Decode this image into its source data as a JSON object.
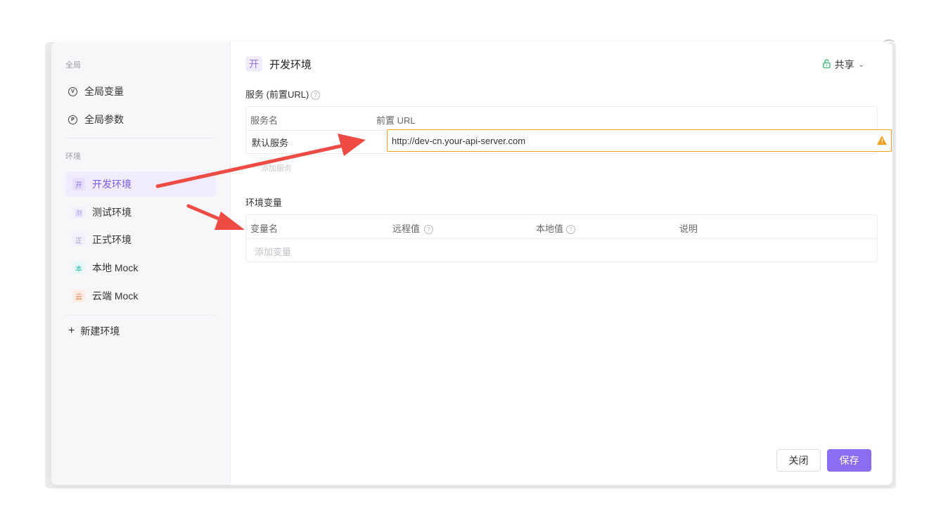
{
  "sidebar": {
    "global_section_label": "全局",
    "global_items": [
      {
        "icon": "circle-v-icon",
        "glyph": "V",
        "label": "全局变量"
      },
      {
        "icon": "circle-p-icon",
        "glyph": "P",
        "label": "全局参数"
      }
    ],
    "env_section_label": "环境",
    "env_items": [
      {
        "badge": "开",
        "label": "开发环境",
        "badge_color": "#9276ee",
        "badge_bg": "#e6defc",
        "active": true
      },
      {
        "badge": "测",
        "label": "测试环境",
        "badge_color": "#a797ec",
        "badge_bg": "#f3f0fd",
        "active": false
      },
      {
        "badge": "正",
        "label": "正式环境",
        "badge_color": "#a797ec",
        "badge_bg": "#f3f0fd",
        "active": false
      },
      {
        "badge": "本",
        "label": "本地 Mock",
        "badge_color": "#2fb7b0",
        "badge_bg": "#e6f7f6",
        "active": false
      },
      {
        "badge": "云",
        "label": "云端 Mock",
        "badge_color": "#f0763f",
        "badge_bg": "#fdede5",
        "active": false
      }
    ],
    "new_env_label": "新建环境"
  },
  "main": {
    "title_badge": "开",
    "title": "开发环境",
    "share_label": "共享",
    "services_title": "服务 (前置URL)",
    "services_table": {
      "col_service_name": "服务名",
      "col_prefix_url": "前置 URL",
      "rows": [
        {
          "name": "默认服务",
          "url": "http://dev-cn.your-api-server.com"
        }
      ],
      "add_label": "添加服务"
    },
    "vars_title": "环境变量",
    "vars_table": {
      "col_var_name": "变量名",
      "col_remote": "远程值",
      "col_local": "本地值",
      "col_desc": "说明",
      "add_placeholder": "添加变量"
    }
  },
  "footer": {
    "close_label": "关闭",
    "save_label": "保存"
  },
  "colors": {
    "accent": "#8c6cf0",
    "warning": "#f2a01e",
    "arrow": "#ef4b45"
  }
}
